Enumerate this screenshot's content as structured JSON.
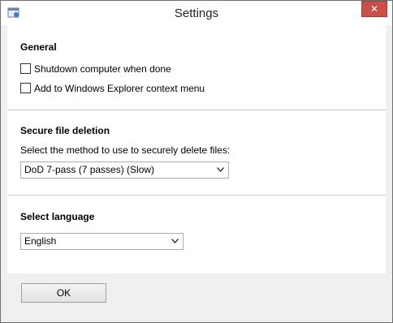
{
  "window": {
    "title": "Settings",
    "close_glyph": "✕"
  },
  "sections": {
    "general": {
      "title": "General",
      "options": [
        {
          "label": "Shutdown computer when done",
          "checked": false
        },
        {
          "label": "Add to Windows Explorer context menu",
          "checked": false
        }
      ]
    },
    "secure_deletion": {
      "title": "Secure file deletion",
      "prompt": "Select the method to use to securely delete files:",
      "selected": "DoD 7-pass (7 passes) (Slow)"
    },
    "language": {
      "title": "Select language",
      "selected": "English"
    }
  },
  "footer": {
    "ok_label": "OK"
  },
  "icons": {
    "app": "app-icon",
    "close": "close-icon",
    "dropdown": "chevron-down-icon"
  },
  "colors": {
    "close_button": "#c7504a",
    "panel": "#ffffff",
    "window_bg": "#f0f0f0"
  }
}
